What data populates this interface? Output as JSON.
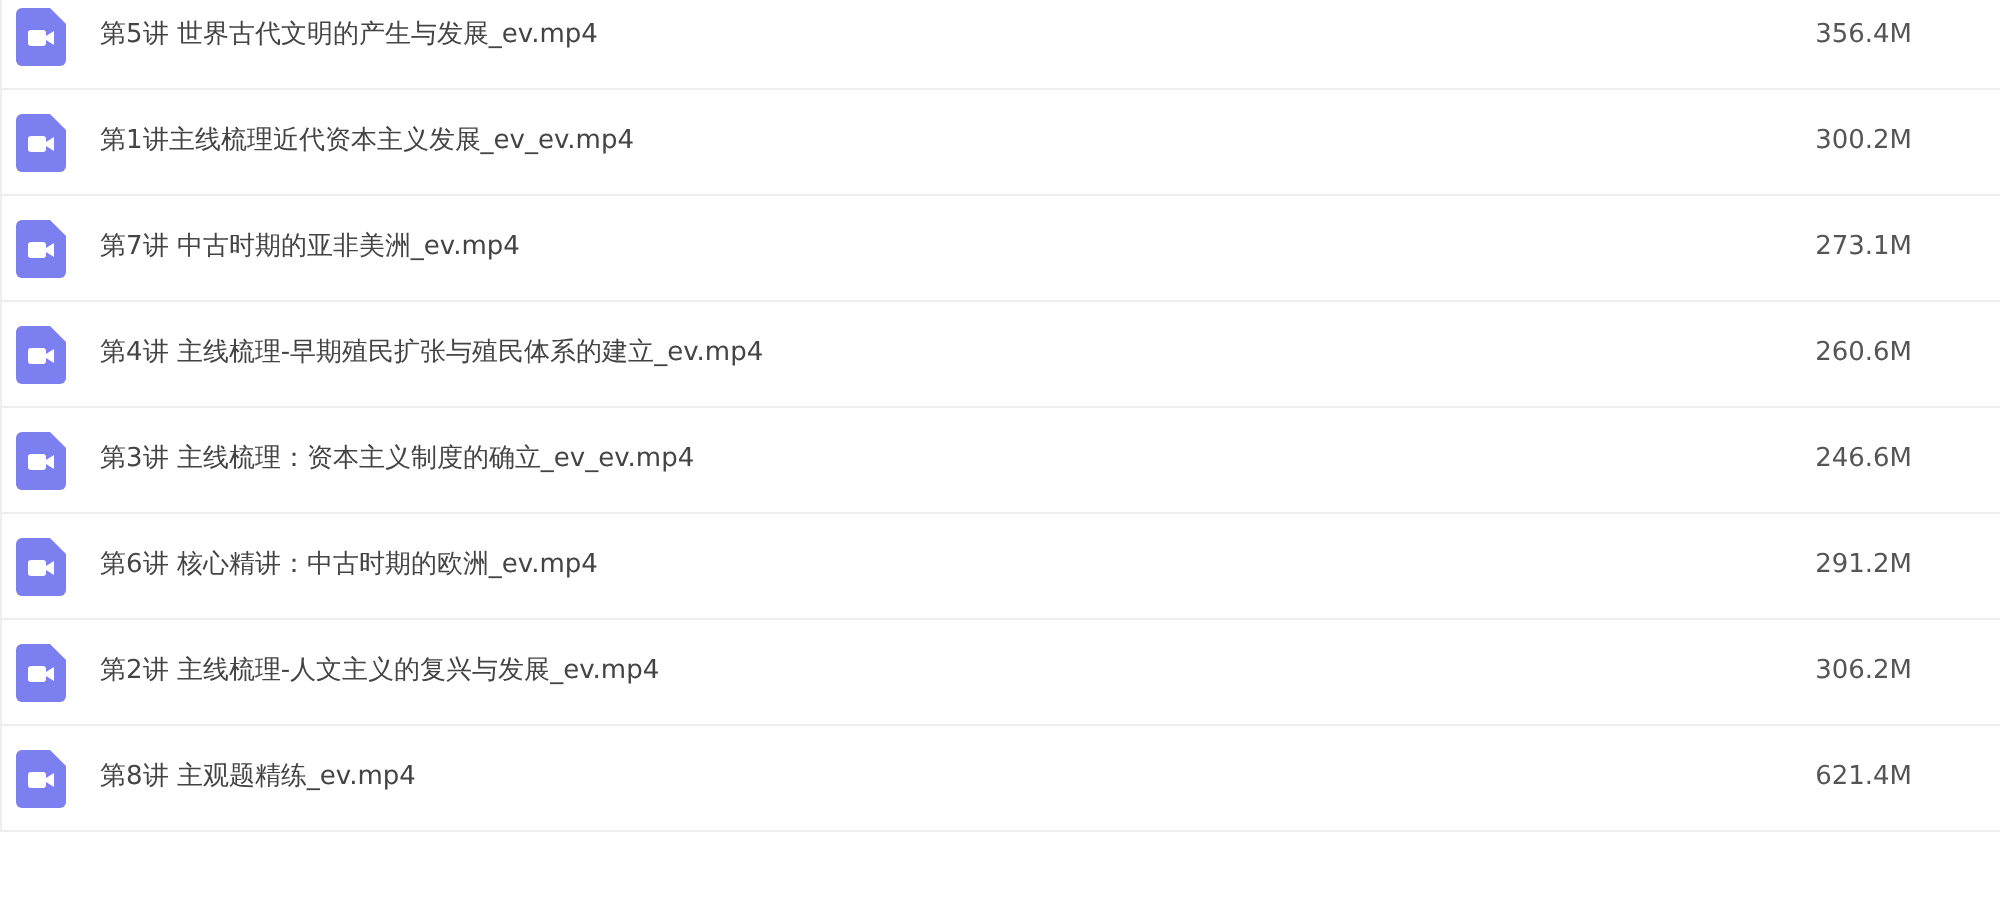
{
  "files": [
    {
      "name": "第5讲 世界古代文明的产生与发展_ev.mp4",
      "size": "356.4M"
    },
    {
      "name": "第1讲主线梳理近代资本主义发展_ev_ev.mp4",
      "size": "300.2M"
    },
    {
      "name": "第7讲 中古时期的亚非美洲_ev.mp4",
      "size": "273.1M"
    },
    {
      "name": "第4讲 主线梳理-早期殖民扩张与殖民体系的建立_ev.mp4",
      "size": "260.6M"
    },
    {
      "name": "第3讲 主线梳理：资本主义制度的确立_ev_ev.mp4",
      "size": "246.6M"
    },
    {
      "name": "第6讲 核心精讲：中古时期的欧洲_ev.mp4",
      "size": "291.2M"
    },
    {
      "name": "第2讲 主线梳理-人文主义的复兴与发展_ev.mp4",
      "size": "306.2M"
    },
    {
      "name": "第8讲 主观题精练_ev.mp4",
      "size": "621.4M"
    }
  ]
}
